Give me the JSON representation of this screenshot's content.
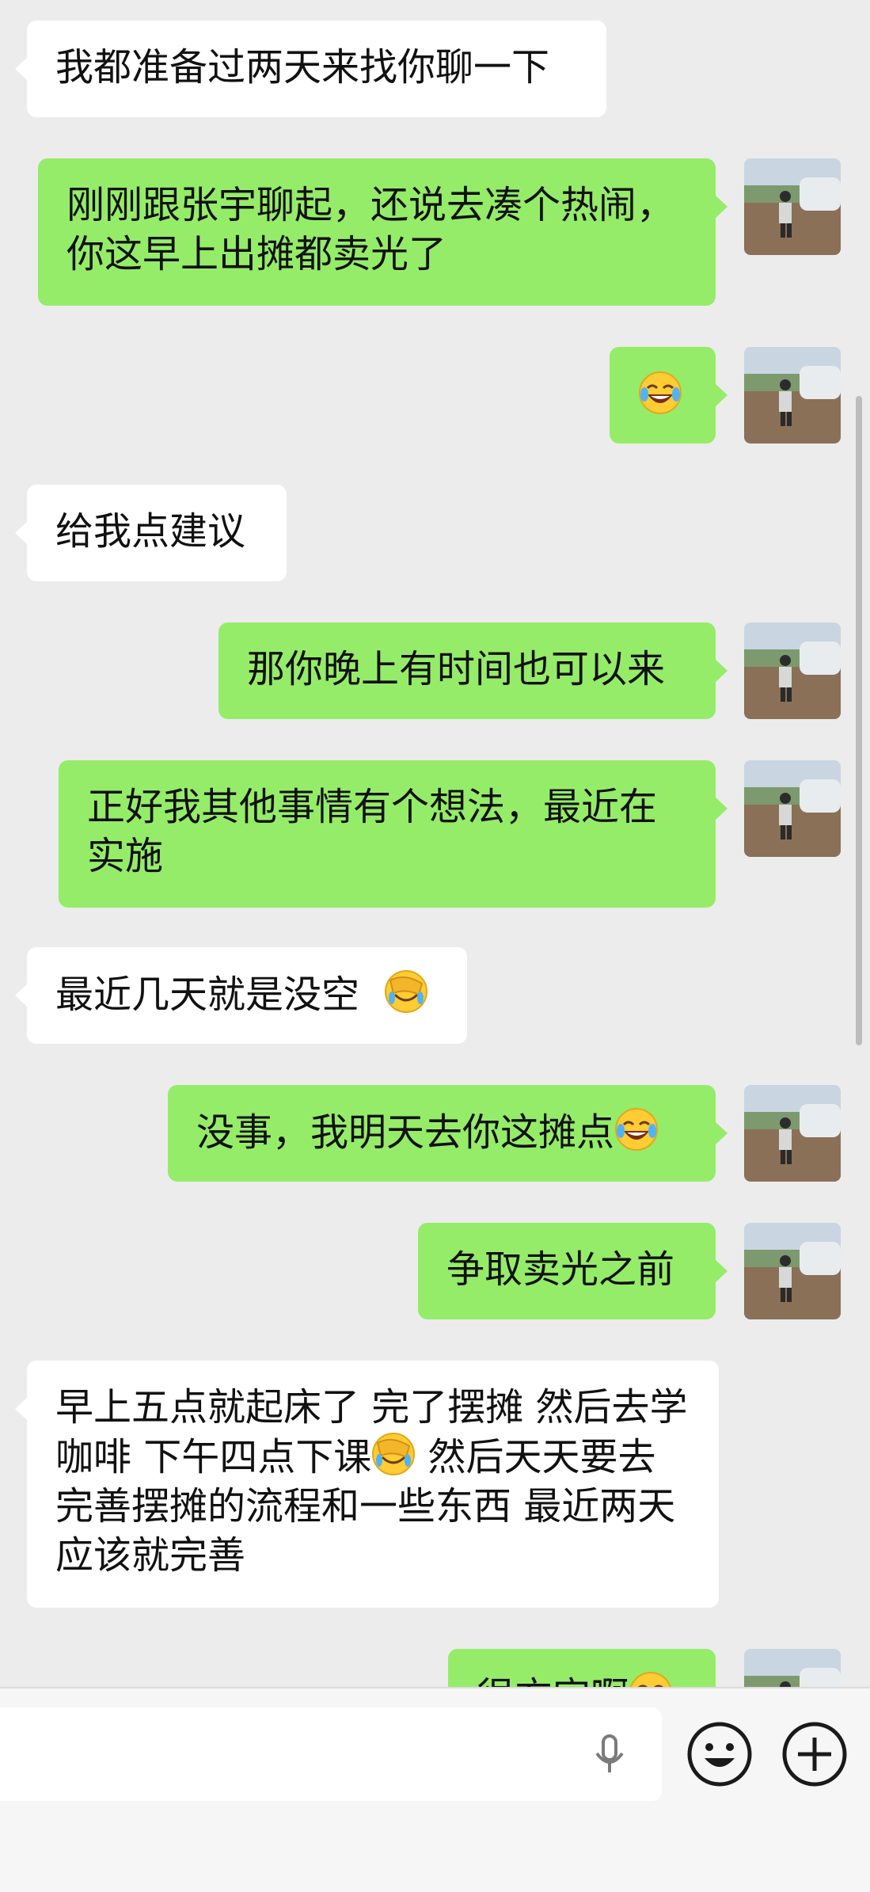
{
  "messages": [
    {
      "side": "in",
      "text": "我都准备过两天来找你聊一下"
    },
    {
      "side": "out",
      "text": "刚刚跟张宇聊起，还说去凑个热闹，你这早上出摊都卖光了"
    },
    {
      "side": "out",
      "emoji": "laugh-cry"
    },
    {
      "side": "in",
      "text": "给我点建议"
    },
    {
      "side": "out",
      "text": "那你晚上有时间也可以来"
    },
    {
      "side": "out",
      "text": "正好我其他事情有个想法，最近在实施"
    },
    {
      "side": "in",
      "text": "最近几天就是没空",
      "emoji": "facepalm"
    },
    {
      "side": "out",
      "text": "没事，我明天去你这摊点",
      "emoji": "laugh-cry"
    },
    {
      "side": "out",
      "text": "争取卖光之前"
    },
    {
      "side": "in",
      "text_a": "早上五点就起床了 完了摆摊 然后去学咖啡 下午四点下课",
      "emoji": "facepalm",
      "text_b": " 然后天天要去完善摆摊的流程和一些东西 最近两天应该就完善"
    },
    {
      "side": "out",
      "text": "很方宜啊",
      "emoji": "laugh-cry"
    }
  ],
  "input_bar": {
    "voice_icon": "mic-icon",
    "emoji_icon": "smiley-icon",
    "more_icon": "plus-icon"
  },
  "colors": {
    "background": "#ececec",
    "incoming_bubble": "#ffffff",
    "outgoing_bubble": "#95ec69",
    "text": "#111111"
  }
}
